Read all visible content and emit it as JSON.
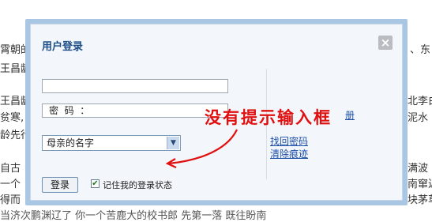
{
  "background": {
    "lines": [
      "霄朝的",
      "王昌龄",
      "王昌龄",
      "贫寒,",
      "龄先行",
      "自古",
      "一个",
      "得而",
      "当济次鹏渊辽了 你一个苦鹿大的校书郎 先第一落 既往盼南"
    ],
    "right_fragments": [
      "、东",
      "北李白",
      "泥水",
      "满波",
      "南窜迟",
      "块茅草"
    ]
  },
  "dialog": {
    "title": "用户登录",
    "close_label": "×",
    "username": {
      "value": "",
      "placeholder": ""
    },
    "password": {
      "value": "密  码  ："
    },
    "security_question": {
      "selected": "母亲的名字"
    },
    "login_button": "登录",
    "remember_checked": "✔",
    "remember_label": "记住我的登录状态",
    "links": {
      "forgot_password": "找回密码",
      "clear_traces": "清除痕迹",
      "partial_link": "册"
    }
  },
  "annotation": {
    "text": "没有提示输入框",
    "color": "#e01010"
  }
}
